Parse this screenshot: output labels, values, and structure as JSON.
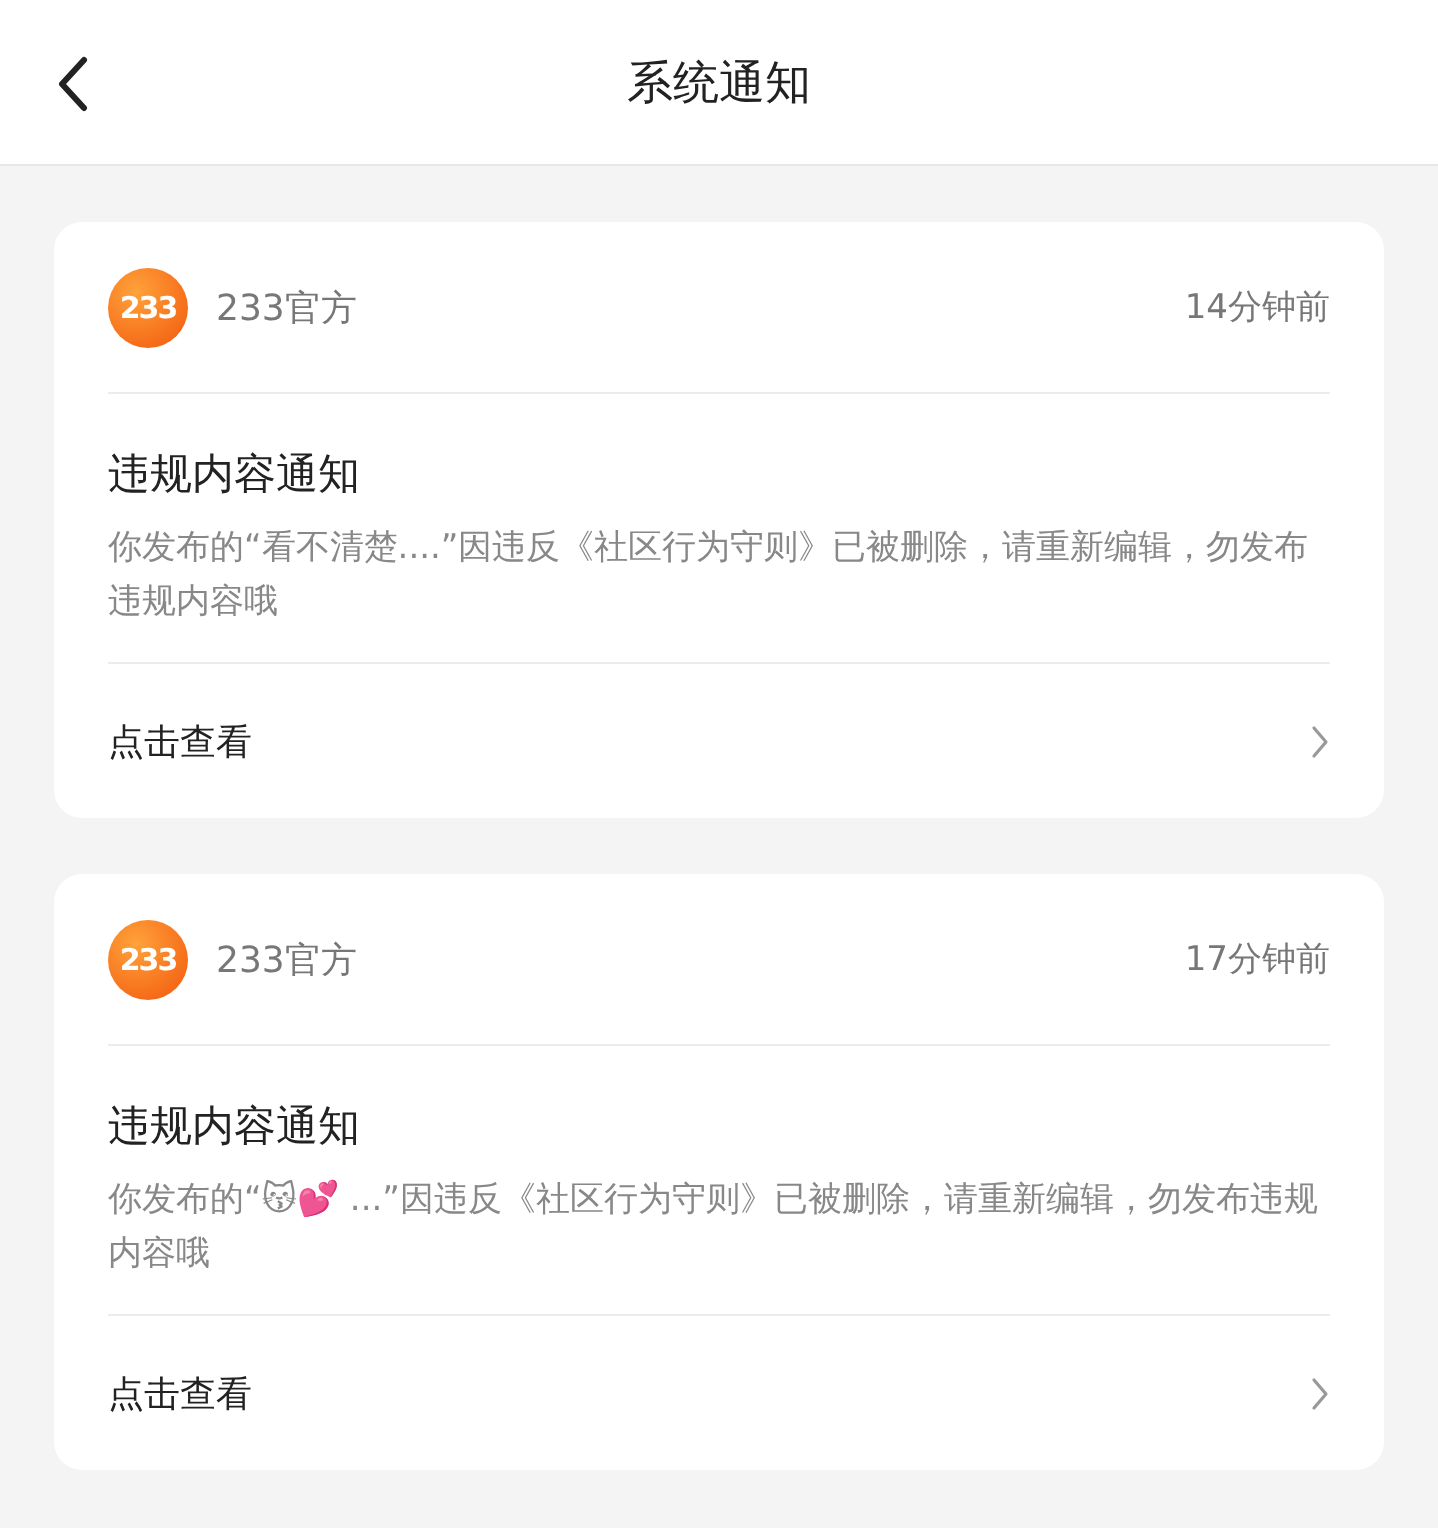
{
  "header": {
    "title": "系统通知"
  },
  "notifications": [
    {
      "logo_text": "233",
      "sender": "233官方",
      "time": "14分钟前",
      "title": "违规内容通知",
      "message": "你发布的“看不清楚....”因违反《社区行为守则》已被删除，请重新编辑，勿发布违规内容哦",
      "action": "点击查看"
    },
    {
      "logo_text": "233",
      "sender": "233官方",
      "time": "17分钟前",
      "title": "违规内容通知",
      "message": "你发布的“😽💕 ...”因违反《社区行为守则》已被删除，请重新编辑，勿发布违规内容哦",
      "action": "点击查看"
    }
  ]
}
